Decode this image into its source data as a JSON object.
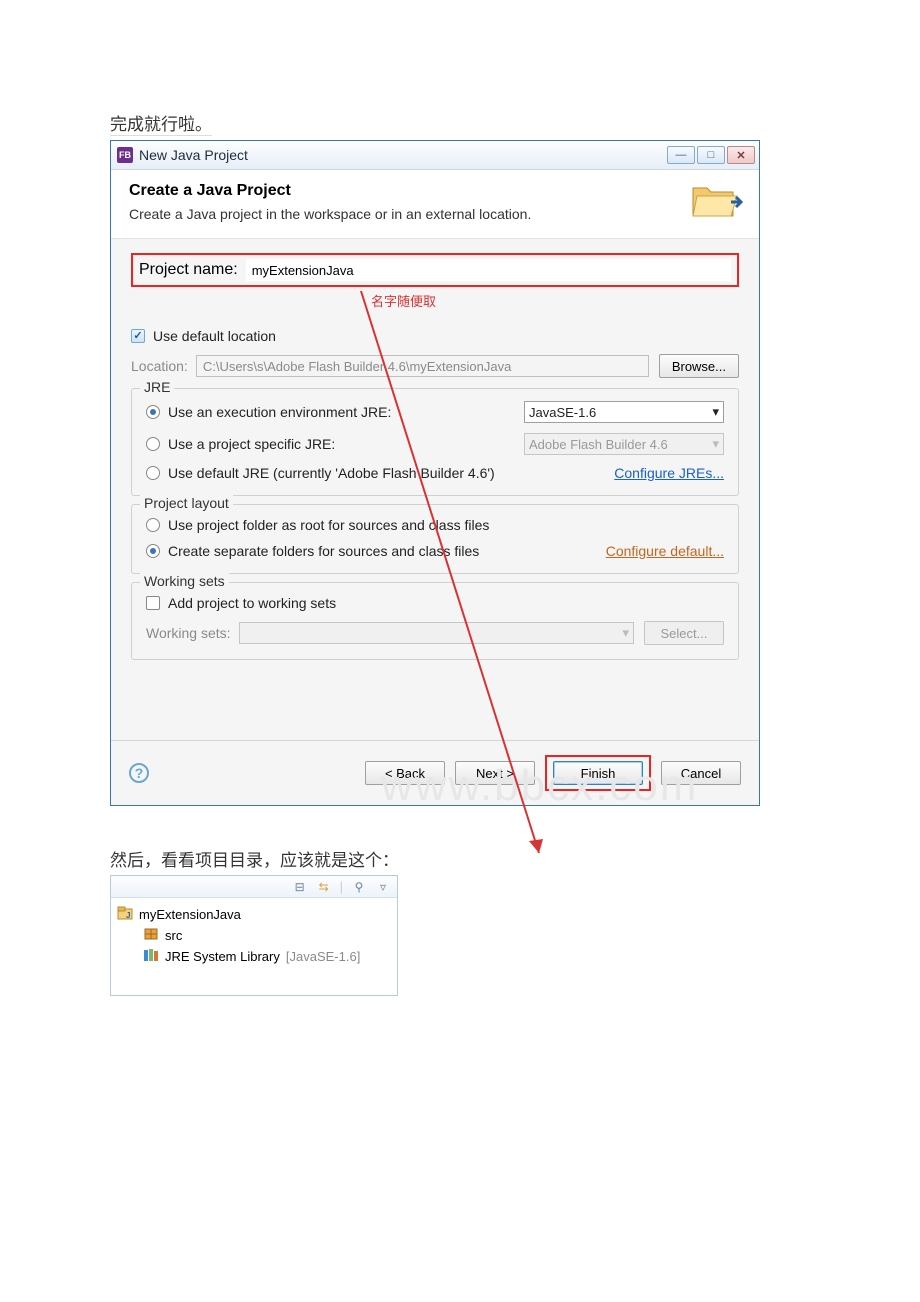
{
  "intro_text": "完成就行啦。",
  "window": {
    "title": "New Java Project"
  },
  "banner": {
    "heading": "Create a Java Project",
    "description": "Create a Java project in the workspace or in an external location."
  },
  "project": {
    "name_label": "Project name:",
    "name_value": "myExtensionJava",
    "name_note": "名字随便取",
    "use_default_label": "Use default location",
    "location_label": "Location:",
    "location_value": "C:\\Users\\s\\Adobe Flash Builder 4.6\\myExtensionJava",
    "browse_label": "Browse..."
  },
  "jre": {
    "title": "JRE",
    "opt_env_label": "Use an execution environment JRE:",
    "env_value": "JavaSE-1.6",
    "opt_specific_label": "Use a project specific JRE:",
    "specific_value": "Adobe Flash Builder 4.6",
    "opt_default_label": "Use default JRE (currently 'Adobe Flash Builder 4.6')",
    "configure_link": "Configure JREs..."
  },
  "layout": {
    "title": "Project layout",
    "opt_root_label": "Use project folder as root for sources and class files",
    "opt_separate_label": "Create separate folders for sources and class files",
    "configure_link": "Configure default..."
  },
  "working": {
    "title": "Working sets",
    "add_label": "Add project to working sets",
    "sets_label": "Working sets:",
    "select_label": "Select..."
  },
  "footer": {
    "back": "< Back",
    "next": "Next >",
    "finish": "Finish",
    "cancel": "Cancel"
  },
  "after_text": "然后，看看项目目录，应该就是这个：",
  "tree": {
    "project": "myExtensionJava",
    "src": "src",
    "lib": "JRE System Library",
    "lib_suffix": "[JavaSE-1.6]"
  },
  "watermark": "www.bbcx.com"
}
